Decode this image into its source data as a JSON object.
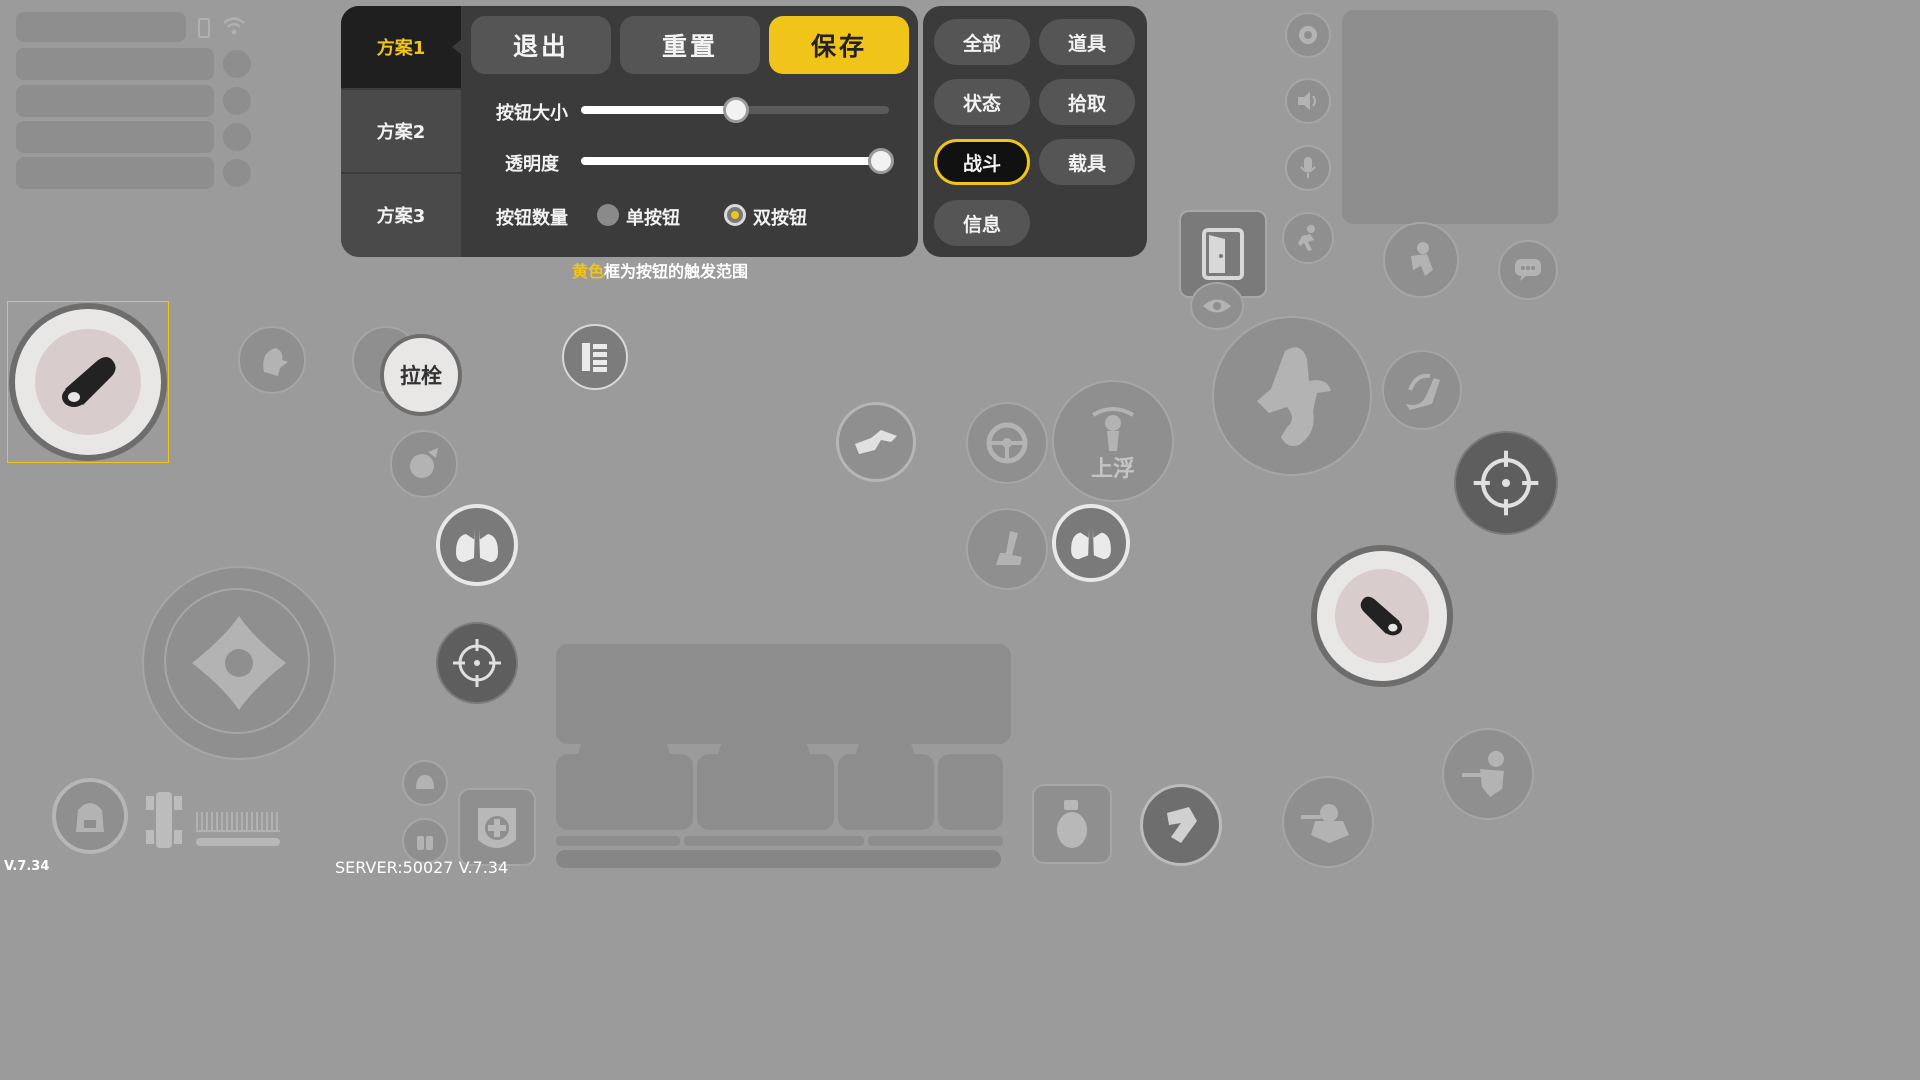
{
  "schemes": [
    {
      "label": "方案1",
      "selected": true
    },
    {
      "label": "方案2",
      "selected": false
    },
    {
      "label": "方案3",
      "selected": false
    }
  ],
  "toolbar": {
    "exit_label": "退出",
    "reset_label": "重置",
    "save_label": "保存"
  },
  "settings": {
    "button_size_label": "按钮大小",
    "button_size_value": 0.5,
    "opacity_label": "透明度",
    "opacity_value": 0.97,
    "button_count_label": "按钮数量",
    "single_label": "单按钮",
    "double_label": "双按钮",
    "selected_count": "双按钮"
  },
  "categories": [
    {
      "label": "全部",
      "selected": false
    },
    {
      "label": "道具",
      "selected": false
    },
    {
      "label": "状态",
      "selected": false
    },
    {
      "label": "拾取",
      "selected": false
    },
    {
      "label": "战斗",
      "selected": true
    },
    {
      "label": "载具",
      "selected": false
    },
    {
      "label": "信息",
      "selected": false
    }
  ],
  "hint": {
    "highlight": "黄色",
    "rest": "框为按钮的触发范围"
  },
  "hud": {
    "bolt_label": "拉栓",
    "float_label": "上浮"
  },
  "footer": {
    "client_version": "V.7.34",
    "server_version": "SERVER:50027 V.7.34"
  },
  "colors": {
    "accent": "#f0c419",
    "panel_bg": "#3b3b3b",
    "button_bg": "#555555",
    "overlay_bg": "#9b9b9b"
  }
}
